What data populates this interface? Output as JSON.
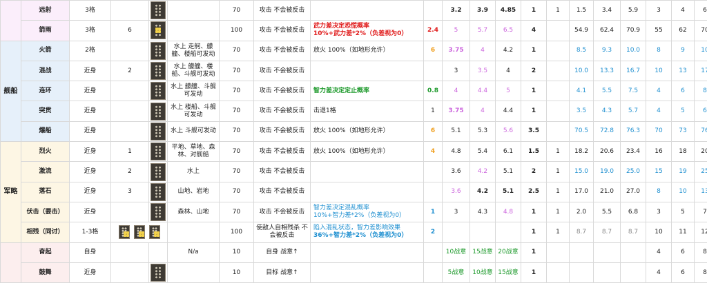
{
  "groups": [
    {
      "name": "",
      "color": "pur",
      "rows": [
        {
          "name": "远射",
          "range": "3格",
          "c3": "",
          "cell5": "",
          "cost": "70",
          "desc": "攻击 不会被反击",
          "effect": "",
          "eff_class": "",
          "eval": "",
          "eval_class": "",
          "v1": "3.2",
          "v1c": "b",
          "v2": "3.9",
          "v2c": "b",
          "v3": "4.85",
          "v3c": "b",
          "t": "1",
          "u": "1",
          "s1": "1.5",
          "s1c": "",
          "s2": "3.4",
          "s2c": "",
          "s3": "5.9",
          "s3c": "",
          "r1": "3",
          "r1c": "",
          "r2": "4",
          "r2c": "",
          "r3": "6",
          "r3c": ""
        },
        {
          "name": "箭雨",
          "range": "3格",
          "c3": "6",
          "cell5": "",
          "cost": "100",
          "desc": "攻击 不会被反击",
          "effect": "武力差决定恐慌概率\n10%+武力差*2%（负差视为0）",
          "eff_class": "red",
          "eval": "2.4",
          "eval_class": "red",
          "v1": "5",
          "v1c": "pink",
          "v2": "5.7",
          "v2c": "pink",
          "v3": "6.5",
          "v3c": "pink",
          "t": "4",
          "u": "",
          "s1": "54.9",
          "s1c": "",
          "s2": "62.4",
          "s2c": "",
          "s3": "70.9",
          "s3c": "",
          "r1": "55",
          "r1c": "",
          "r2": "62",
          "r2c": "",
          "r3": "70",
          "r3c": ""
        }
      ]
    },
    {
      "name": "舰船",
      "color": "blu",
      "rows": [
        {
          "name": "火箭",
          "range": "2格",
          "c3": "",
          "cell5": "水上 走舸、艨艟、楼船可发动",
          "cost": "70",
          "desc": "攻击 不会被反击",
          "effect": "放火 100%（如地形允许）",
          "eff_class": "",
          "eval": "6",
          "eval_class": "orange",
          "v1": "3.75",
          "v1c": "pinkb",
          "v2": "4",
          "v2c": "pink",
          "v3": "4.2",
          "v3c": "",
          "t": "1",
          "u": "",
          "s1": "8.5",
          "s1c": "cyan",
          "s2": "9.3",
          "s2c": "cyan",
          "s3": "10.0",
          "s3c": "cyan",
          "r1": "8",
          "r1c": "cyan",
          "r2": "9",
          "r2c": "cyan",
          "r3": "10",
          "r3c": "cyan"
        },
        {
          "name": "混战",
          "range": "近身",
          "c3": "2",
          "cell5": "水上 艨艟、楼船、斗舰可发动",
          "cost": "70",
          "desc": "攻击 不会被反击",
          "effect": "",
          "eff_class": "",
          "eval": "",
          "eval_class": "",
          "v1": "3",
          "v1c": "",
          "v2": "3.5",
          "v2c": "pink",
          "v3": "4",
          "v3c": "",
          "t": "2",
          "u": "",
          "s1": "10.0",
          "s1c": "cyan",
          "s2": "13.3",
          "s2c": "cyan",
          "s3": "16.7",
          "s3c": "cyan",
          "r1": "10",
          "r1c": "cyan",
          "r2": "13",
          "r2c": "cyan",
          "r3": "17",
          "r3c": "cyan"
        },
        {
          "name": "连环",
          "range": "近身",
          "c3": "",
          "cell5": "水上 艨艟、斗舰可发动",
          "cost": "70",
          "desc": "攻击 不会被反击",
          "effect": "智力差决定定止概率",
          "eff_class": "green",
          "eval": "0.8",
          "eval_class": "green",
          "v1": "4",
          "v1c": "pink",
          "v2": "4.4",
          "v2c": "pink",
          "v3": "5",
          "v3c": "pink",
          "t": "1",
          "u": "",
          "s1": "4.1",
          "s1c": "cyan",
          "s2": "5.5",
          "s2c": "cyan",
          "s3": "7.5",
          "s3c": "cyan",
          "r1": "4",
          "r1c": "cyan",
          "r2": "6",
          "r2c": "cyan",
          "r3": "8",
          "r3c": "cyan"
        },
        {
          "name": "突贯",
          "range": "近身",
          "c3": "",
          "cell5": "水上 楼船、斗舰可发动",
          "cost": "70",
          "desc": "攻击 不会被反击",
          "effect": "击退1格",
          "eff_class": "",
          "eval": "1",
          "eval_class": "",
          "v1": "3.75",
          "v1c": "pinkb",
          "v2": "4",
          "v2c": "pink",
          "v3": "4.4",
          "v3c": "",
          "t": "1",
          "u": "",
          "s1": "3.5",
          "s1c": "cyan",
          "s2": "4.3",
          "s2c": "cyan",
          "s3": "5.7",
          "s3c": "cyan",
          "r1": "4",
          "r1c": "cyan",
          "r2": "5",
          "r2c": "cyan",
          "r3": "6",
          "r3c": "cyan"
        },
        {
          "name": "爆船",
          "range": "近身",
          "c3": "",
          "cell5": "水上 斗舰可发动",
          "cost": "70",
          "desc": "攻击 不会被反击",
          "effect": "放火 100%（如地形允许）",
          "eff_class": "",
          "eval": "6",
          "eval_class": "orange",
          "v1": "5.1",
          "v1c": "",
          "v2": "5.3",
          "v2c": "",
          "v3": "5.6",
          "v3c": "pink",
          "t": "3.5",
          "u": "",
          "s1": "70.5",
          "s1c": "cyan",
          "s2": "72.8",
          "s2c": "cyan",
          "s3": "76.3",
          "s3c": "cyan",
          "r1": "70",
          "r1c": "cyan",
          "r2": "73",
          "r2c": "cyan",
          "r3": "76",
          "r3c": "cyan"
        }
      ]
    },
    {
      "name": "军略",
      "color": "yel",
      "rows": [
        {
          "name": "烈火",
          "range": "近身",
          "c3": "1",
          "cell5": "平地、草地、森林、对舰船",
          "cost": "70",
          "desc": "攻击 不会被反击",
          "effect": "放火 100%（如地形允许）",
          "eff_class": "",
          "eval": "4",
          "eval_class": "orange",
          "v1": "4.8",
          "v1c": "",
          "v2": "5.4",
          "v2c": "",
          "v3": "6.1",
          "v3c": "",
          "t": "1.5",
          "u": "1",
          "s1": "18.2",
          "s1c": "",
          "s2": "20.6",
          "s2c": "",
          "s3": "23.4",
          "s3c": "",
          "r1": "16",
          "r1c": "",
          "r2": "18",
          "r2c": "",
          "r3": "20",
          "r3c": ""
        },
        {
          "name": "激流",
          "range": "近身",
          "c3": "2",
          "cell5": "水上",
          "cost": "70",
          "desc": "攻击 不会被反击",
          "effect": "",
          "eff_class": "",
          "eval": "",
          "eval_class": "",
          "v1": "3.6",
          "v1c": "",
          "v2": "4.2",
          "v2c": "pink",
          "v3": "5.1",
          "v3c": "",
          "t": "2",
          "u": "1",
          "s1": "15.0",
          "s1c": "cyan",
          "s2": "19.0",
          "s2c": "cyan",
          "s3": "25.0",
          "s3c": "cyan",
          "r1": "15",
          "r1c": "cyan",
          "r2": "19",
          "r2c": "cyan",
          "r3": "25",
          "r3c": "cyan"
        },
        {
          "name": "落石",
          "range": "近身",
          "c3": "3",
          "cell5": "山地、岩地",
          "cost": "70",
          "desc": "攻击 不会被反击",
          "effect": "",
          "eff_class": "",
          "eval": "",
          "eval_class": "",
          "v1": "3.6",
          "v1c": "pink",
          "v2": "4.2",
          "v2c": "b",
          "v3": "5.1",
          "v3c": "b",
          "t": "2.5",
          "u": "1",
          "s1": "17.0",
          "s1c": "",
          "s2": "21.0",
          "s2c": "",
          "s3": "27.0",
          "s3c": "",
          "r1": "8",
          "r1c": "cyan",
          "r2": "10",
          "r2c": "cyan",
          "r3": "13",
          "r3c": "cyan"
        },
        {
          "name": "伏击（要击）",
          "range": "近身",
          "c3": "",
          "cell5": "森林、山地",
          "cost": "70",
          "desc": "攻击 不会被反击",
          "effect": "智力差决定混乱概率\n10%+智力差*2%（负差视为0）",
          "eff_class": "cyan",
          "eval": "1",
          "eval_class": "cyanb",
          "v1": "3",
          "v1c": "",
          "v2": "4.3",
          "v2c": "",
          "v3": "4.8",
          "v3c": "pink",
          "t": "1",
          "u": "1",
          "s1": "2.0",
          "s1c": "",
          "s2": "5.5",
          "s2c": "",
          "s3": "6.8",
          "s3c": "",
          "r1": "3",
          "r1c": "",
          "r2": "5",
          "r2c": "",
          "r3": "7",
          "r3c": ""
        },
        {
          "name": "相残（同讨）",
          "range": "1-3格",
          "c3": "icons",
          "cell5": "",
          "cost": "100",
          "desc": "使敌人自相残杀\n不会被反击",
          "effect": "陷入混乱状态，智力差影响效果\n36%+智力差*2%（负差视为0）",
          "eff_class": "cyanmix",
          "eval": "2",
          "eval_class": "cyanb",
          "v1": "",
          "v1c": "",
          "v2": "",
          "v2c": "",
          "v3": "",
          "v3c": "",
          "t": "1",
          "u": "1",
          "s1": "8.7",
          "s1c": "gray",
          "s2": "8.7",
          "s2c": "gray",
          "s3": "8.7",
          "s3c": "gray",
          "r1": "10",
          "r1c": "",
          "r2": "11",
          "r2c": "",
          "r3": "12",
          "r3c": ""
        }
      ]
    },
    {
      "name": "",
      "color": "pnk",
      "rows": [
        {
          "name": "奋起",
          "range": "自身",
          "c3": "",
          "cell5": "N/a",
          "cost": "10",
          "desc": "自身 战意↑",
          "effect": "",
          "eff_class": "",
          "eval": "",
          "eval_class": "",
          "v1": "10战意",
          "v1c": "g",
          "v2": "15战意",
          "v2c": "g",
          "v3": "20战意",
          "v3c": "g",
          "t": "1",
          "u": "",
          "s1": "",
          "s1c": "",
          "s2": "",
          "s2c": "",
          "s3": "",
          "s3c": "",
          "r1": "4",
          "r1c": "",
          "r2": "6",
          "r2c": "",
          "r3": "8",
          "r3c": ""
        },
        {
          "name": "鼓舞",
          "range": "近身",
          "c3": "",
          "cell5": "",
          "cost": "10",
          "desc": "目标 战意↑",
          "effect": "",
          "eff_class": "",
          "eval": "",
          "eval_class": "",
          "v1": "5战意",
          "v1c": "g",
          "v2": "10战意",
          "v2c": "g",
          "v3": "15战意",
          "v3c": "g",
          "t": "1",
          "u": "",
          "s1": "",
          "s1c": "",
          "s2": "",
          "s2c": "",
          "s3": "",
          "s3c": "",
          "r1": "4",
          "r1c": "",
          "r2": "6",
          "r2c": "",
          "r3": "8",
          "r3c": ""
        }
      ]
    }
  ]
}
